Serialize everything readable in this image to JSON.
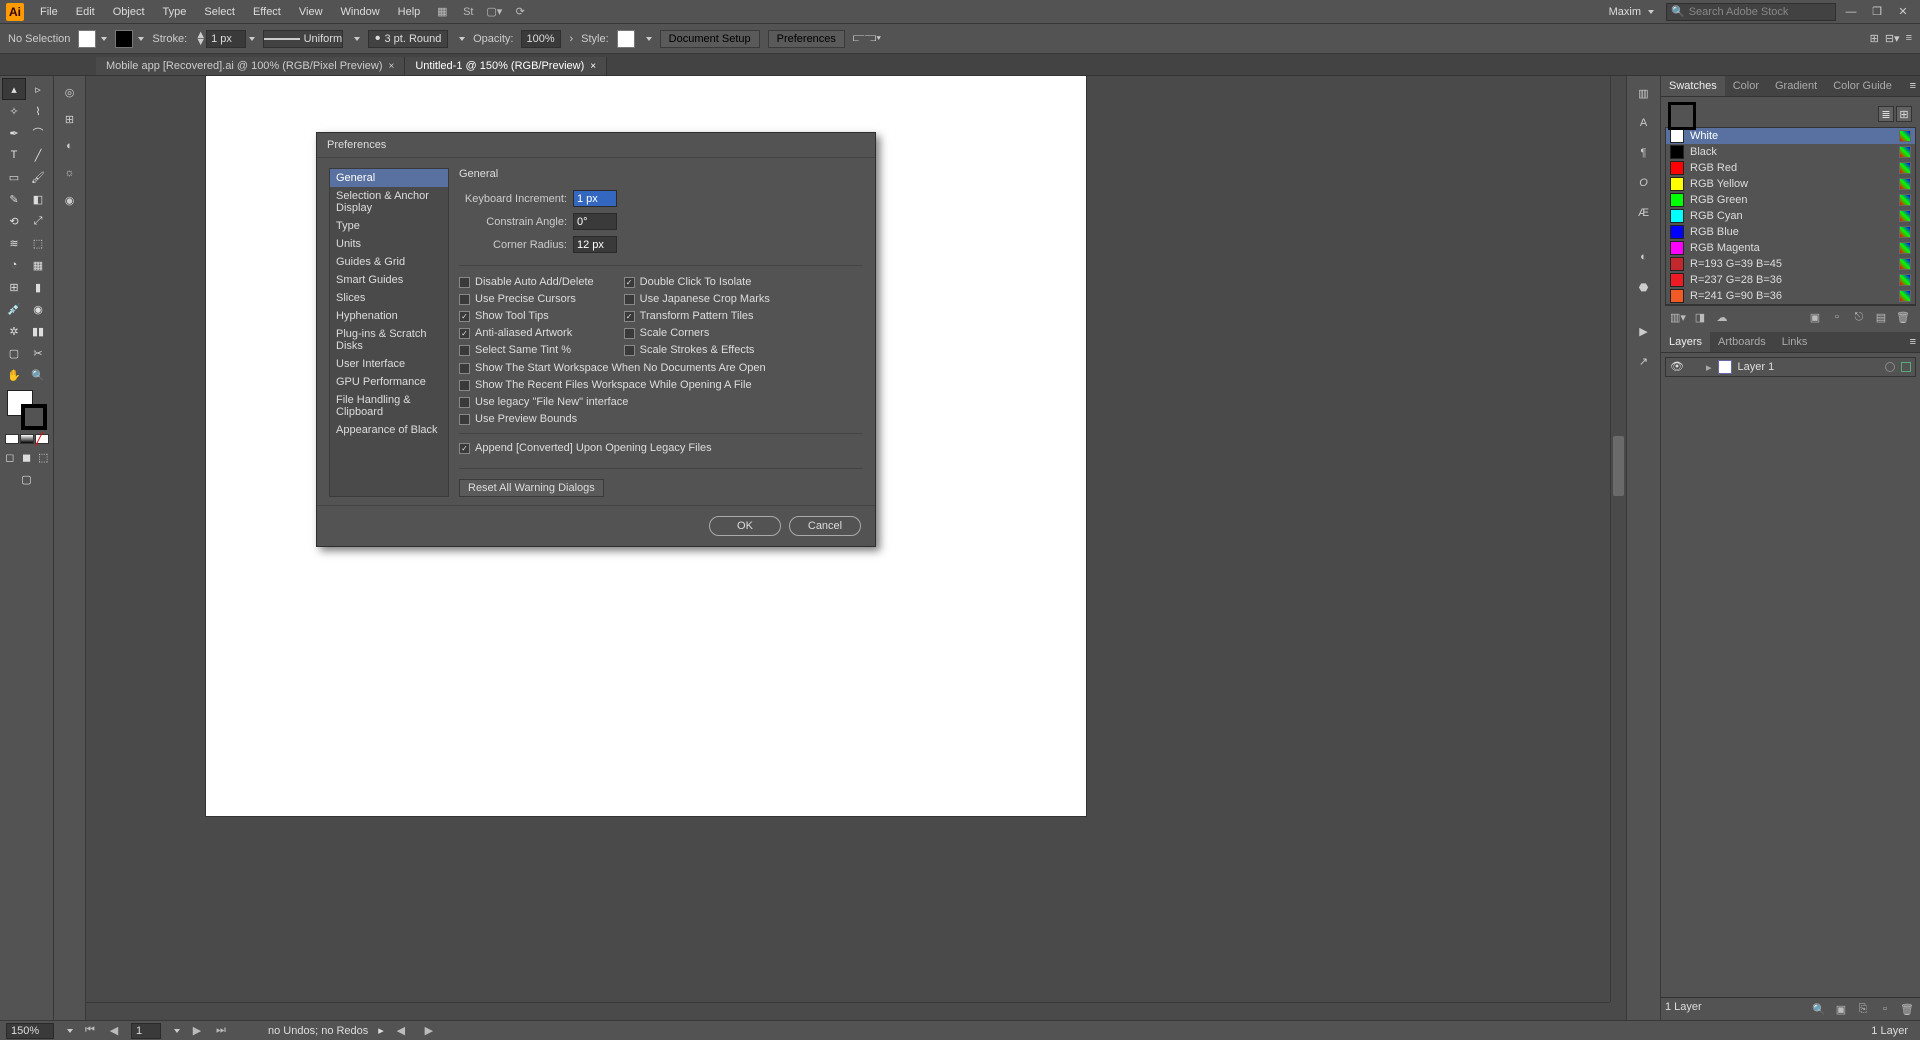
{
  "menubar": {
    "items": [
      "File",
      "Edit",
      "Object",
      "Type",
      "Select",
      "Effect",
      "View",
      "Window",
      "Help"
    ],
    "user": "Maxim",
    "search_placeholder": "Search Adobe Stock"
  },
  "optbar": {
    "selection": "No Selection",
    "stroke_label": "Stroke:",
    "stroke_value": "1 px",
    "profile": "Uniform",
    "brush": "3 pt. Round",
    "opacity_label": "Opacity:",
    "opacity_value": "100%",
    "style_label": "Style:",
    "btn1": "Document Setup",
    "btn2": "Preferences"
  },
  "tabs": [
    {
      "label": "Mobile app [Recovered].ai @ 100% (RGB/Pixel Preview)",
      "active": false
    },
    {
      "label": "Untitled-1 @ 150% (RGB/Preview)",
      "active": true
    }
  ],
  "dialog": {
    "title": "Preferences",
    "categories": [
      "General",
      "Selection & Anchor Display",
      "Type",
      "Units",
      "Guides & Grid",
      "Smart Guides",
      "Slices",
      "Hyphenation",
      "Plug-ins & Scratch Disks",
      "User Interface",
      "GPU Performance",
      "File Handling & Clipboard",
      "Appearance of Black"
    ],
    "section": "General",
    "fields": {
      "kb_label": "Keyboard Increment:",
      "kb_value": "1 px",
      "angle_label": "Constrain Angle:",
      "angle_value": "0°",
      "radius_label": "Corner Radius:",
      "radius_value": "12 px"
    },
    "checks_left": [
      {
        "label": "Disable Auto Add/Delete",
        "on": false
      },
      {
        "label": "Use Precise Cursors",
        "on": false
      },
      {
        "label": "Show Tool Tips",
        "on": true
      },
      {
        "label": "Anti-aliased Artwork",
        "on": true
      },
      {
        "label": "Select Same Tint %",
        "on": false
      }
    ],
    "checks_right": [
      {
        "label": "Double Click To Isolate",
        "on": true
      },
      {
        "label": "Use Japanese Crop Marks",
        "on": false
      },
      {
        "label": "Transform Pattern Tiles",
        "on": true
      },
      {
        "label": "Scale Corners",
        "on": false
      },
      {
        "label": "Scale Strokes & Effects",
        "on": false
      }
    ],
    "checks_wide": [
      {
        "label": "Show The Start Workspace When No Documents Are Open",
        "on": false
      },
      {
        "label": "Show The Recent Files Workspace While Opening A File",
        "on": false
      },
      {
        "label": "Use legacy \"File New\" interface",
        "on": false
      },
      {
        "label": "Use Preview Bounds",
        "on": false
      }
    ],
    "check_append": {
      "label": "Append [Converted] Upon Opening Legacy Files",
      "on": true
    },
    "reset_btn": "Reset All Warning Dialogs",
    "ok": "OK",
    "cancel": "Cancel"
  },
  "swatches": {
    "tabs": [
      "Swatches",
      "Color",
      "Gradient",
      "Color Guide"
    ],
    "list": [
      {
        "name": "White",
        "color": "#ffffff",
        "selected": true
      },
      {
        "name": "Black",
        "color": "#000000"
      },
      {
        "name": "RGB Red",
        "color": "#ff0000"
      },
      {
        "name": "RGB Yellow",
        "color": "#ffff00"
      },
      {
        "name": "RGB Green",
        "color": "#00ff00"
      },
      {
        "name": "RGB Cyan",
        "color": "#00ffff"
      },
      {
        "name": "RGB Blue",
        "color": "#0000ff"
      },
      {
        "name": "RGB Magenta",
        "color": "#ff00ff"
      },
      {
        "name": "R=193 G=39 B=45",
        "color": "#c1272d"
      },
      {
        "name": "R=237 G=28 B=36",
        "color": "#ed1c24"
      },
      {
        "name": "R=241 G=90 B=36",
        "color": "#f15a24"
      }
    ]
  },
  "layers": {
    "tabs": [
      "Layers",
      "Artboards",
      "Links"
    ],
    "rows": [
      {
        "name": "Layer 1"
      }
    ],
    "count": "1 Layer"
  },
  "status": {
    "zoom": "150%",
    "artboard": "1",
    "undo": "no Undos; no Redos"
  }
}
